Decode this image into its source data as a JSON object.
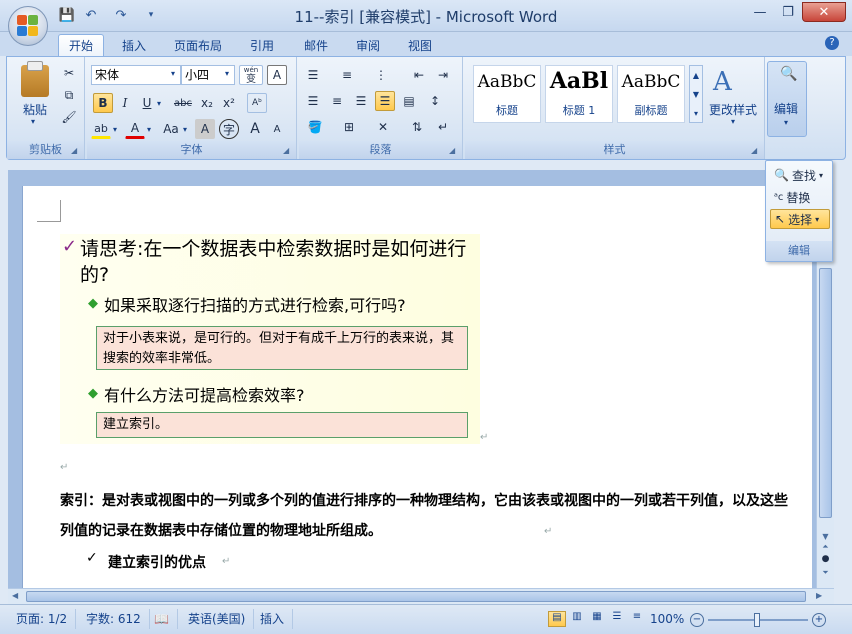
{
  "title": "11--索引 [兼容模式] - Microsoft Word",
  "tabs": [
    "开始",
    "插入",
    "页面布局",
    "引用",
    "邮件",
    "审阅",
    "视图"
  ],
  "clipboard": {
    "paste": "粘贴",
    "group": "剪贴板"
  },
  "font": {
    "name": "宋体",
    "size": "小四",
    "group": "字体",
    "grow": "A",
    "shrink": "A",
    "bold": "B",
    "italic": "I",
    "underline": "U",
    "strike": "abc",
    "sub": "x₂",
    "sup": "x²",
    "highlight": "ab",
    "color": "A",
    "case": "Aa",
    "shade": "A",
    "circled": "字",
    "wen": "wén",
    "bianwen": "变"
  },
  "paragraph": {
    "group": "段落"
  },
  "styles": {
    "group": "样式",
    "items": [
      {
        "sample": "AaBbC",
        "name": "标题"
      },
      {
        "sample": "AaBl",
        "name": "标题 1"
      },
      {
        "sample": "AaBbC",
        "name": "副标题"
      }
    ],
    "change": "更改样式"
  },
  "edit": {
    "label": "编辑",
    "find": "查找",
    "replace": "替换",
    "select": "选择",
    "group": "编辑"
  },
  "slide": {
    "question": "请思考:在一个数据表中检索数据时是如何进行的?",
    "q1": "如果采取逐行扫描的方式进行检索,可行吗?",
    "a1": "对于小表来说，是可行的。但对于有成千上万行的表来说，其搜索的效率非常低。",
    "q2": "有什么方法可提高检索效率?",
    "a2": "建立索引。"
  },
  "body": {
    "definition": "索引：是对表或视图中的一列或多个列的值进行排序的一种物理结构，它由该表或视图中的一列或若干列值，以及这些列值的记录在数据表中存储位置的物理地址所组成。",
    "bullet": "建立索引的优点"
  },
  "status": {
    "page": "页面: 1/2",
    "words": "字数: 612",
    "lang": "英语(美国)",
    "mode": "插入",
    "zoom": "100%"
  }
}
